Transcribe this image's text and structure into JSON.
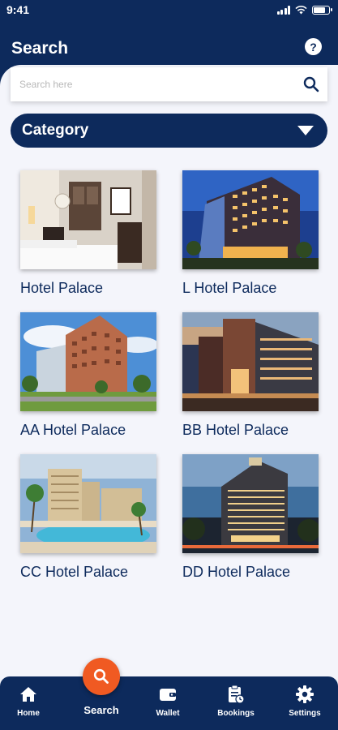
{
  "status_bar": {
    "time": "9:41"
  },
  "header": {
    "title": "Search",
    "help_icon": "help-icon"
  },
  "search": {
    "placeholder": "Search here",
    "value": ""
  },
  "category": {
    "label": "Category"
  },
  "hotels": [
    {
      "name": "Hotel Palace"
    },
    {
      "name": "L Hotel Palace"
    },
    {
      "name": "AA Hotel Palace"
    },
    {
      "name": "BB Hotel Palace"
    },
    {
      "name": "CC Hotel Palace"
    },
    {
      "name": "DD Hotel Palace"
    }
  ],
  "bottom_nav": {
    "items": [
      {
        "label": "Home",
        "icon": "home-icon"
      },
      {
        "label": "Search",
        "icon": "search-icon",
        "active": true
      },
      {
        "label": "Wallet",
        "icon": "wallet-icon"
      },
      {
        "label": "Bookings",
        "icon": "bookings-icon"
      },
      {
        "label": "Settings",
        "icon": "gear-icon"
      }
    ]
  },
  "colors": {
    "primary": "#0d2a5c",
    "accent": "#f05a22",
    "background": "#f4f5fb"
  }
}
